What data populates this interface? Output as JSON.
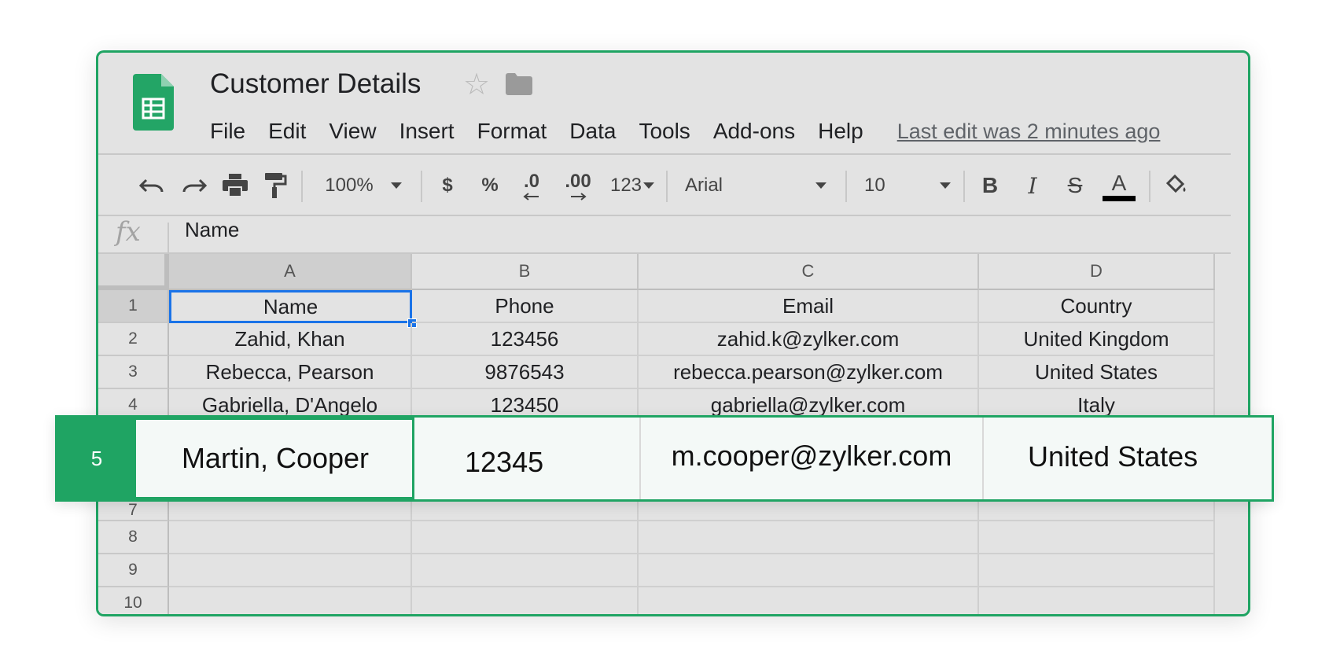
{
  "document": {
    "title": "Customer Details"
  },
  "menu": [
    "File",
    "Edit",
    "View",
    "Insert",
    "Format",
    "Data",
    "Tools",
    "Add-ons",
    "Help"
  ],
  "last_edit": "Last edit was 2 minutes ago",
  "toolbar": {
    "zoom": "100%",
    "currency": "$",
    "percent": "%",
    "decrease_decimal": ".0",
    "increase_decimal": ".00",
    "more_formats": "123",
    "font": "Arial",
    "font_size": "10",
    "bold": "B",
    "italic": "I",
    "strikethrough": "S",
    "text_color": "A"
  },
  "formula_bar": {
    "label": "fx",
    "value": "Name"
  },
  "columns": [
    "A",
    "B",
    "C",
    "D"
  ],
  "rows": [
    {
      "num": "1",
      "cells": [
        "Name",
        "Phone",
        "Email",
        "Country"
      ]
    },
    {
      "num": "2",
      "cells": [
        "Zahid, Khan",
        "123456",
        "zahid.k@zylker.com",
        "United Kingdom"
      ]
    },
    {
      "num": "3",
      "cells": [
        "Rebecca, Pearson",
        "9876543",
        "rebecca.pearson@zylker.com",
        "United States"
      ]
    },
    {
      "num": "4",
      "cells": [
        "Gabriella, D'Angelo",
        "123450",
        "gabriella@zylker.com",
        "Italy"
      ]
    },
    {
      "num": "7",
      "cells": [
        "",
        "",
        "",
        ""
      ]
    },
    {
      "num": "8",
      "cells": [
        "",
        "",
        "",
        ""
      ]
    },
    {
      "num": "9",
      "cells": [
        "",
        "",
        "",
        ""
      ]
    },
    {
      "num": "10",
      "cells": [
        "",
        "",
        "",
        ""
      ]
    }
  ],
  "highlight_row": {
    "num": "5",
    "cells": [
      "Martin, Cooper",
      "12345",
      "m.cooper@zylker.com",
      "United States"
    ]
  },
  "colors": {
    "accent": "#1fa463",
    "selection": "#1a73e8"
  }
}
